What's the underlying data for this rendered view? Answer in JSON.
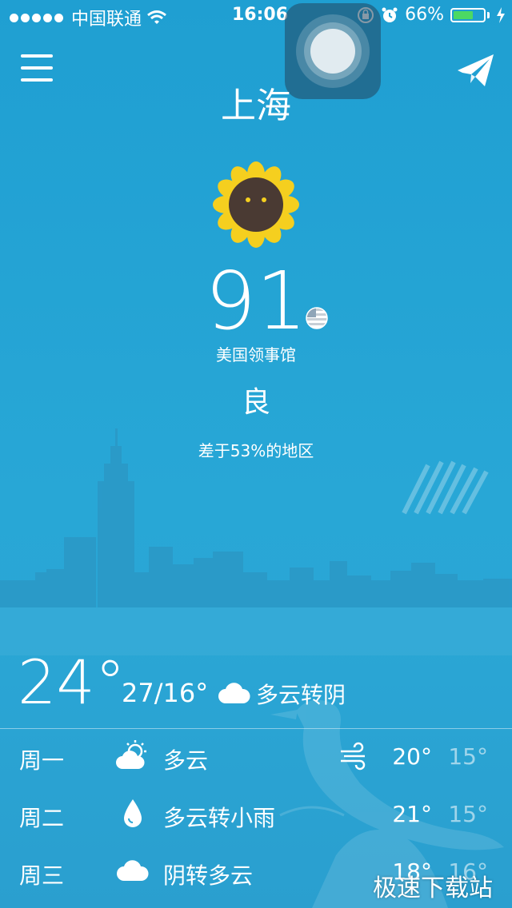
{
  "status_bar": {
    "carrier": "中国联通",
    "time": "16:06",
    "battery": "66%",
    "battery_level": 0.66
  },
  "header": {
    "city": "上海"
  },
  "aqi": {
    "value": "91",
    "station": "美国领事馆",
    "level": "良",
    "compare": "差于53%的地区"
  },
  "current": {
    "temp": "24°",
    "range": "27/16°",
    "condition": "多云转阴"
  },
  "forecast": [
    {
      "day": "周一",
      "icon": "partly-cloudy-icon",
      "condition": "多云",
      "wind_icon": "wind-icon",
      "high": "20°",
      "low": "15°"
    },
    {
      "day": "周二",
      "icon": "rain-drop-icon",
      "condition": "多云转小雨",
      "high": "21°",
      "low": "15°"
    },
    {
      "day": "周三",
      "icon": "cloud-icon",
      "condition": "阴转多云",
      "high": "18°",
      "low": "16°"
    }
  ],
  "watermark": "极速下载站",
  "colors": {
    "background": "#1f9fd2",
    "sunflower_petal": "#f5cf1f",
    "sunflower_center": "#4a3a33",
    "battery_fill": "#4cd964"
  }
}
